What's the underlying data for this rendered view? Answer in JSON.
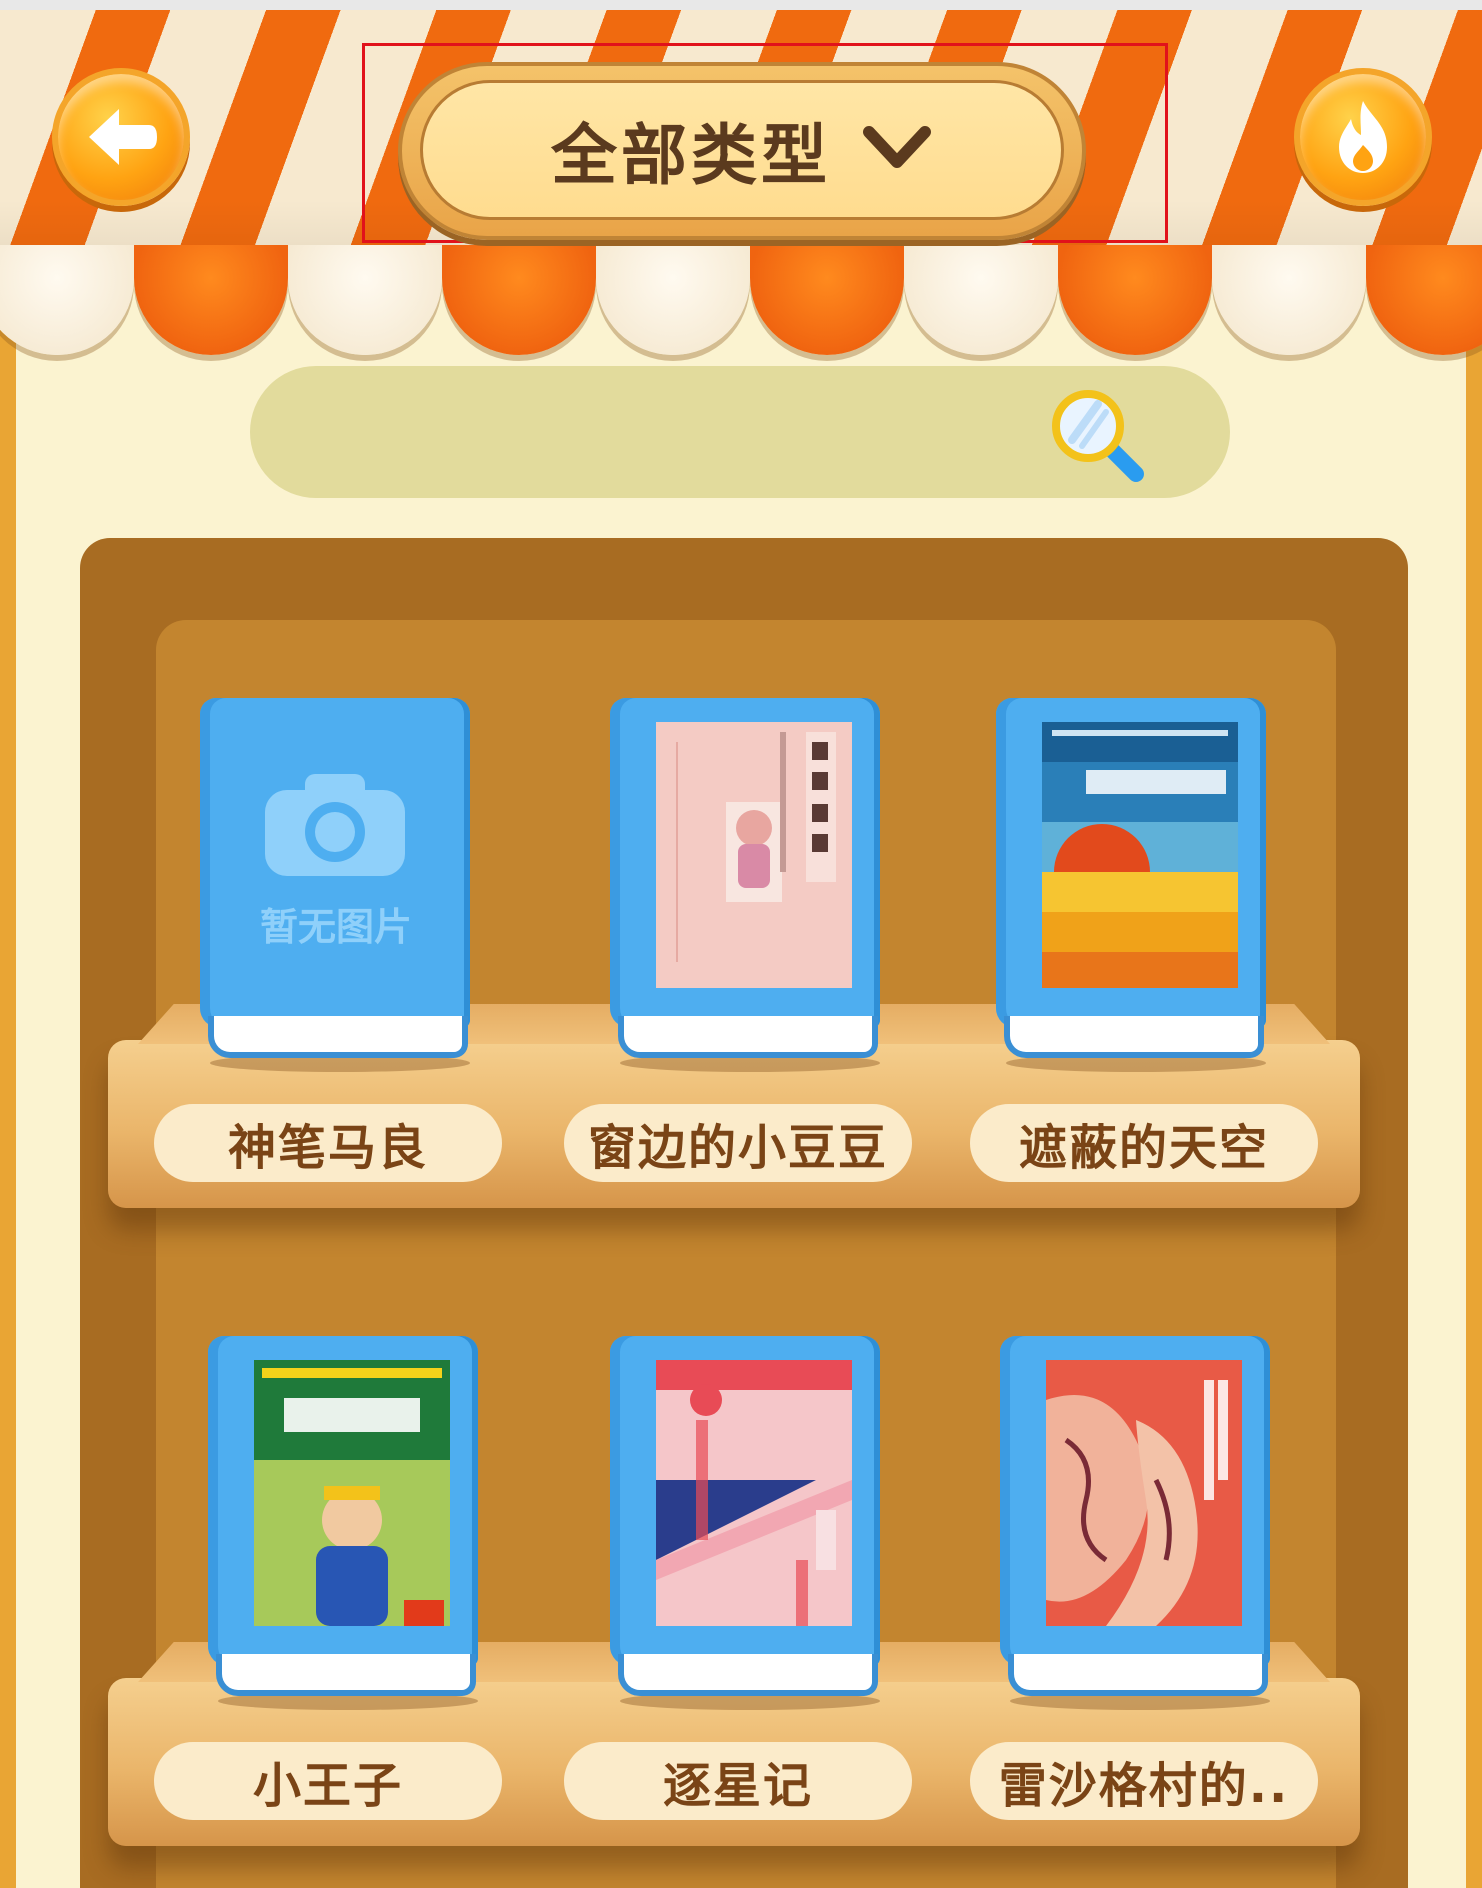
{
  "header": {
    "category_selector": {
      "label": "全部类型"
    }
  },
  "search": {
    "placeholder": ""
  },
  "books": [
    {
      "title": "神笔马良",
      "cover_text": "暂无图片"
    },
    {
      "title": "窗边的小豆豆"
    },
    {
      "title": "遮蔽的天空"
    },
    {
      "title": "小王子"
    },
    {
      "title": "逐星记"
    },
    {
      "title": "雷沙格村的.."
    }
  ],
  "colors": {
    "awning_orange": "#f06a0f",
    "awning_cream": "#f7e9cf",
    "button_orange": "#ffa312",
    "shelf_wood": "#eab56a",
    "case_brown": "#a86c22",
    "book_blue": "#4eaef0",
    "label_text": "#7a4416"
  },
  "icons": {
    "back": "back-arrow-icon",
    "hot": "flame-icon",
    "dropdown": "chevron-down-icon",
    "search": "magnifier-icon",
    "placeholder": "camera-icon"
  }
}
